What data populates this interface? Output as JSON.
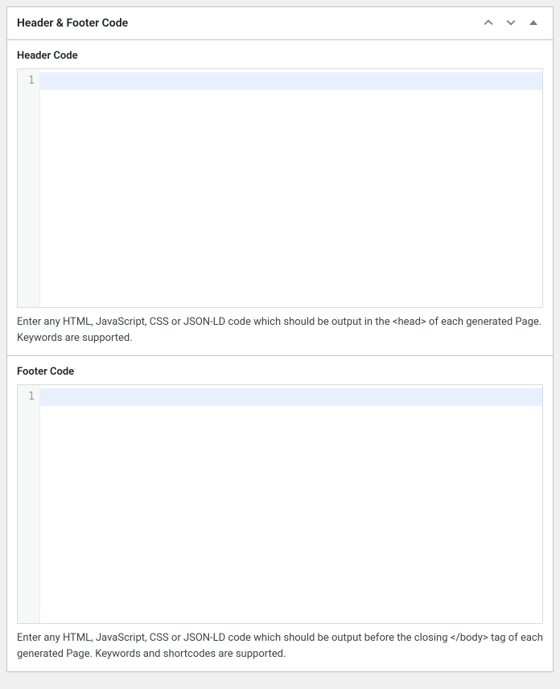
{
  "metabox": {
    "title": "Header & Footer Code"
  },
  "sections": {
    "header": {
      "label": "Header Code",
      "line_number": "1",
      "code_value": "",
      "help_text": "Enter any HTML, JavaScript, CSS or JSON-LD code which should be output in the <head> of each generated Page. Keywords are supported."
    },
    "footer": {
      "label": "Footer Code",
      "line_number": "1",
      "code_value": "",
      "help_text": "Enter any HTML, JavaScript, CSS or JSON-LD code which should be output before the closing </body> tag of each generated Page. Keywords and shortcodes are supported."
    }
  }
}
